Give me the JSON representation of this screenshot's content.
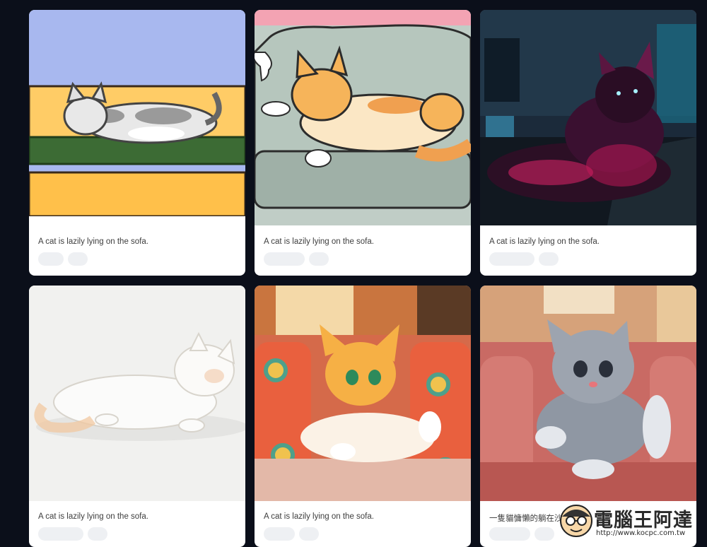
{
  "cards": [
    {
      "caption": "A cat is lazily lying on the sofa.",
      "style": "pixel-art",
      "tags": [
        "",
        ""
      ]
    },
    {
      "caption": "A cat is lazily lying on the sofa.",
      "style": "comic",
      "tags": [
        "",
        ""
      ]
    },
    {
      "caption": "A cat is lazily lying on the sofa.",
      "style": "cyberpunk",
      "tags": [
        "",
        ""
      ]
    },
    {
      "caption": "A cat is lazily lying on the sofa.",
      "style": "watercolor",
      "tags": [
        "",
        ""
      ]
    },
    {
      "caption": "A cat is lazily lying on the sofa.",
      "style": "cartoon",
      "tags": [
        "",
        ""
      ]
    },
    {
      "caption": "一隻貓慵懶的躺在沙發",
      "style": "3d-render",
      "tags": [
        "",
        ""
      ]
    }
  ],
  "watermark": {
    "brand": "電腦王阿達",
    "url": "http://www.kocpc.com.tw"
  },
  "colors": {
    "background": "#0b0f1a",
    "card": "#ffffff",
    "tag": "#eef0f3"
  }
}
